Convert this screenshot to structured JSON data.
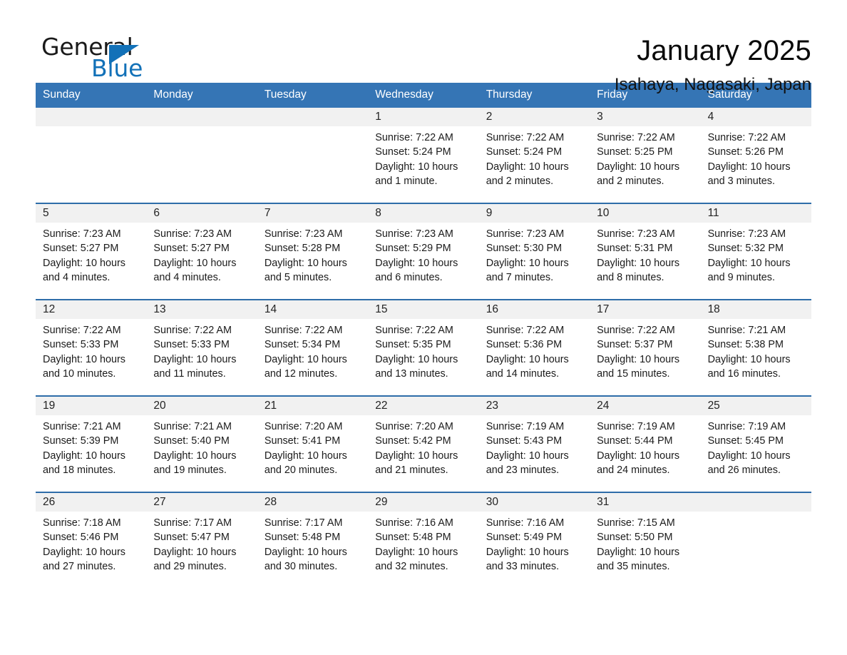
{
  "brand": {
    "word_one": "General",
    "word_two": "Blue",
    "accent_color": "#1271b8"
  },
  "header": {
    "title": "January 2025",
    "subtitle": "Isahaya, Nagasaki, Japan",
    "header_bg": "#3575b5",
    "row_divider": "#2e6da9",
    "daynum_bg": "#f1f1f1"
  },
  "weekdays": [
    "Sunday",
    "Monday",
    "Tuesday",
    "Wednesday",
    "Thursday",
    "Friday",
    "Saturday"
  ],
  "weeks": [
    [
      {
        "day": "",
        "lines": []
      },
      {
        "day": "",
        "lines": []
      },
      {
        "day": "",
        "lines": []
      },
      {
        "day": "1",
        "lines": [
          "Sunrise: 7:22 AM",
          "Sunset: 5:24 PM",
          "Daylight: 10 hours",
          "and 1 minute."
        ]
      },
      {
        "day": "2",
        "lines": [
          "Sunrise: 7:22 AM",
          "Sunset: 5:24 PM",
          "Daylight: 10 hours",
          "and 2 minutes."
        ]
      },
      {
        "day": "3",
        "lines": [
          "Sunrise: 7:22 AM",
          "Sunset: 5:25 PM",
          "Daylight: 10 hours",
          "and 2 minutes."
        ]
      },
      {
        "day": "4",
        "lines": [
          "Sunrise: 7:22 AM",
          "Sunset: 5:26 PM",
          "Daylight: 10 hours",
          "and 3 minutes."
        ]
      }
    ],
    [
      {
        "day": "5",
        "lines": [
          "Sunrise: 7:23 AM",
          "Sunset: 5:27 PM",
          "Daylight: 10 hours",
          "and 4 minutes."
        ]
      },
      {
        "day": "6",
        "lines": [
          "Sunrise: 7:23 AM",
          "Sunset: 5:27 PM",
          "Daylight: 10 hours",
          "and 4 minutes."
        ]
      },
      {
        "day": "7",
        "lines": [
          "Sunrise: 7:23 AM",
          "Sunset: 5:28 PM",
          "Daylight: 10 hours",
          "and 5 minutes."
        ]
      },
      {
        "day": "8",
        "lines": [
          "Sunrise: 7:23 AM",
          "Sunset: 5:29 PM",
          "Daylight: 10 hours",
          "and 6 minutes."
        ]
      },
      {
        "day": "9",
        "lines": [
          "Sunrise: 7:23 AM",
          "Sunset: 5:30 PM",
          "Daylight: 10 hours",
          "and 7 minutes."
        ]
      },
      {
        "day": "10",
        "lines": [
          "Sunrise: 7:23 AM",
          "Sunset: 5:31 PM",
          "Daylight: 10 hours",
          "and 8 minutes."
        ]
      },
      {
        "day": "11",
        "lines": [
          "Sunrise: 7:23 AM",
          "Sunset: 5:32 PM",
          "Daylight: 10 hours",
          "and 9 minutes."
        ]
      }
    ],
    [
      {
        "day": "12",
        "lines": [
          "Sunrise: 7:22 AM",
          "Sunset: 5:33 PM",
          "Daylight: 10 hours",
          "and 10 minutes."
        ]
      },
      {
        "day": "13",
        "lines": [
          "Sunrise: 7:22 AM",
          "Sunset: 5:33 PM",
          "Daylight: 10 hours",
          "and 11 minutes."
        ]
      },
      {
        "day": "14",
        "lines": [
          "Sunrise: 7:22 AM",
          "Sunset: 5:34 PM",
          "Daylight: 10 hours",
          "and 12 minutes."
        ]
      },
      {
        "day": "15",
        "lines": [
          "Sunrise: 7:22 AM",
          "Sunset: 5:35 PM",
          "Daylight: 10 hours",
          "and 13 minutes."
        ]
      },
      {
        "day": "16",
        "lines": [
          "Sunrise: 7:22 AM",
          "Sunset: 5:36 PM",
          "Daylight: 10 hours",
          "and 14 minutes."
        ]
      },
      {
        "day": "17",
        "lines": [
          "Sunrise: 7:22 AM",
          "Sunset: 5:37 PM",
          "Daylight: 10 hours",
          "and 15 minutes."
        ]
      },
      {
        "day": "18",
        "lines": [
          "Sunrise: 7:21 AM",
          "Sunset: 5:38 PM",
          "Daylight: 10 hours",
          "and 16 minutes."
        ]
      }
    ],
    [
      {
        "day": "19",
        "lines": [
          "Sunrise: 7:21 AM",
          "Sunset: 5:39 PM",
          "Daylight: 10 hours",
          "and 18 minutes."
        ]
      },
      {
        "day": "20",
        "lines": [
          "Sunrise: 7:21 AM",
          "Sunset: 5:40 PM",
          "Daylight: 10 hours",
          "and 19 minutes."
        ]
      },
      {
        "day": "21",
        "lines": [
          "Sunrise: 7:20 AM",
          "Sunset: 5:41 PM",
          "Daylight: 10 hours",
          "and 20 minutes."
        ]
      },
      {
        "day": "22",
        "lines": [
          "Sunrise: 7:20 AM",
          "Sunset: 5:42 PM",
          "Daylight: 10 hours",
          "and 21 minutes."
        ]
      },
      {
        "day": "23",
        "lines": [
          "Sunrise: 7:19 AM",
          "Sunset: 5:43 PM",
          "Daylight: 10 hours",
          "and 23 minutes."
        ]
      },
      {
        "day": "24",
        "lines": [
          "Sunrise: 7:19 AM",
          "Sunset: 5:44 PM",
          "Daylight: 10 hours",
          "and 24 minutes."
        ]
      },
      {
        "day": "25",
        "lines": [
          "Sunrise: 7:19 AM",
          "Sunset: 5:45 PM",
          "Daylight: 10 hours",
          "and 26 minutes."
        ]
      }
    ],
    [
      {
        "day": "26",
        "lines": [
          "Sunrise: 7:18 AM",
          "Sunset: 5:46 PM",
          "Daylight: 10 hours",
          "and 27 minutes."
        ]
      },
      {
        "day": "27",
        "lines": [
          "Sunrise: 7:17 AM",
          "Sunset: 5:47 PM",
          "Daylight: 10 hours",
          "and 29 minutes."
        ]
      },
      {
        "day": "28",
        "lines": [
          "Sunrise: 7:17 AM",
          "Sunset: 5:48 PM",
          "Daylight: 10 hours",
          "and 30 minutes."
        ]
      },
      {
        "day": "29",
        "lines": [
          "Sunrise: 7:16 AM",
          "Sunset: 5:48 PM",
          "Daylight: 10 hours",
          "and 32 minutes."
        ]
      },
      {
        "day": "30",
        "lines": [
          "Sunrise: 7:16 AM",
          "Sunset: 5:49 PM",
          "Daylight: 10 hours",
          "and 33 minutes."
        ]
      },
      {
        "day": "31",
        "lines": [
          "Sunrise: 7:15 AM",
          "Sunset: 5:50 PM",
          "Daylight: 10 hours",
          "and 35 minutes."
        ]
      },
      {
        "day": "",
        "lines": []
      }
    ]
  ]
}
